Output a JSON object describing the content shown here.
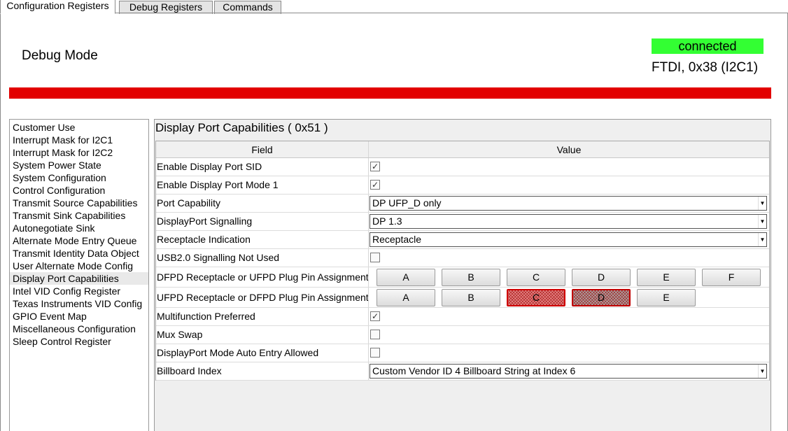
{
  "tabs": [
    "Configuration Registers",
    "Debug Registers",
    "Commands"
  ],
  "header": {
    "mode": "Debug Mode",
    "status": "connected",
    "adapter": "FTDI, 0x38 (I2C1)"
  },
  "colors": {
    "status_ok": "#33ff33",
    "alert_bar": "#e20000",
    "selected_pin": "#e58a8a"
  },
  "sidebar": {
    "items": [
      "Customer Use",
      "Interrupt Mask for I2C1",
      "Interrupt Mask for I2C2",
      "System Power State",
      "System Configuration",
      "Control Configuration",
      "Transmit Source Capabilities",
      "Transmit Sink Capabilities",
      "Autonegotiate Sink",
      "Alternate Mode Entry Queue",
      "Transmit Identity Data Object",
      "User Alternate Mode Config",
      "Display Port Capabilities",
      "Intel VID Config Register",
      "Texas Instruments VID Config",
      "GPIO Event Map",
      "Miscellaneous Configuration",
      "Sleep Control Register"
    ],
    "selected": "Display Port Capabilities"
  },
  "panel": {
    "title": "Display Port Capabilities  ( 0x51 )",
    "columns": {
      "field": "Field",
      "value": "Value"
    },
    "rows": {
      "r0": {
        "field": "Enable Display Port SID",
        "checked": true,
        "mark": "✓"
      },
      "r1": {
        "field": "Enable Display Port Mode 1",
        "checked": true,
        "mark": "✓"
      },
      "r2": {
        "field": "Port Capability",
        "value": "DP UFP_D only"
      },
      "r3": {
        "field": "DisplayPort Signalling",
        "value": "DP 1.3"
      },
      "r4": {
        "field": "Receptacle Indication",
        "value": "Receptacle"
      },
      "r5": {
        "field": "USB2.0 Signalling Not Used",
        "checked": false,
        "mark": ""
      },
      "r6": {
        "field": "DFPD Receptacle or UFPD Plug Pin Assignment",
        "pins": [
          "A",
          "B",
          "C",
          "D",
          "E",
          "F"
        ],
        "selected": []
      },
      "r7": {
        "field": "UFPD Receptacle or DFPD Plug Pin Assignment",
        "pins": [
          "A",
          "B",
          "C",
          "D",
          "E"
        ],
        "selected": [
          "C",
          "D"
        ]
      },
      "r8": {
        "field": "Multifunction Preferred",
        "checked": true,
        "mark": "✓"
      },
      "r9": {
        "field": "Mux Swap",
        "checked": false,
        "mark": ""
      },
      "r10": {
        "field": "DisplayPort Mode Auto Entry Allowed",
        "checked": false,
        "mark": ""
      },
      "r11": {
        "field": "Billboard Index",
        "value": "Custom Vendor ID 4 Billboard String at Index 6"
      }
    }
  }
}
